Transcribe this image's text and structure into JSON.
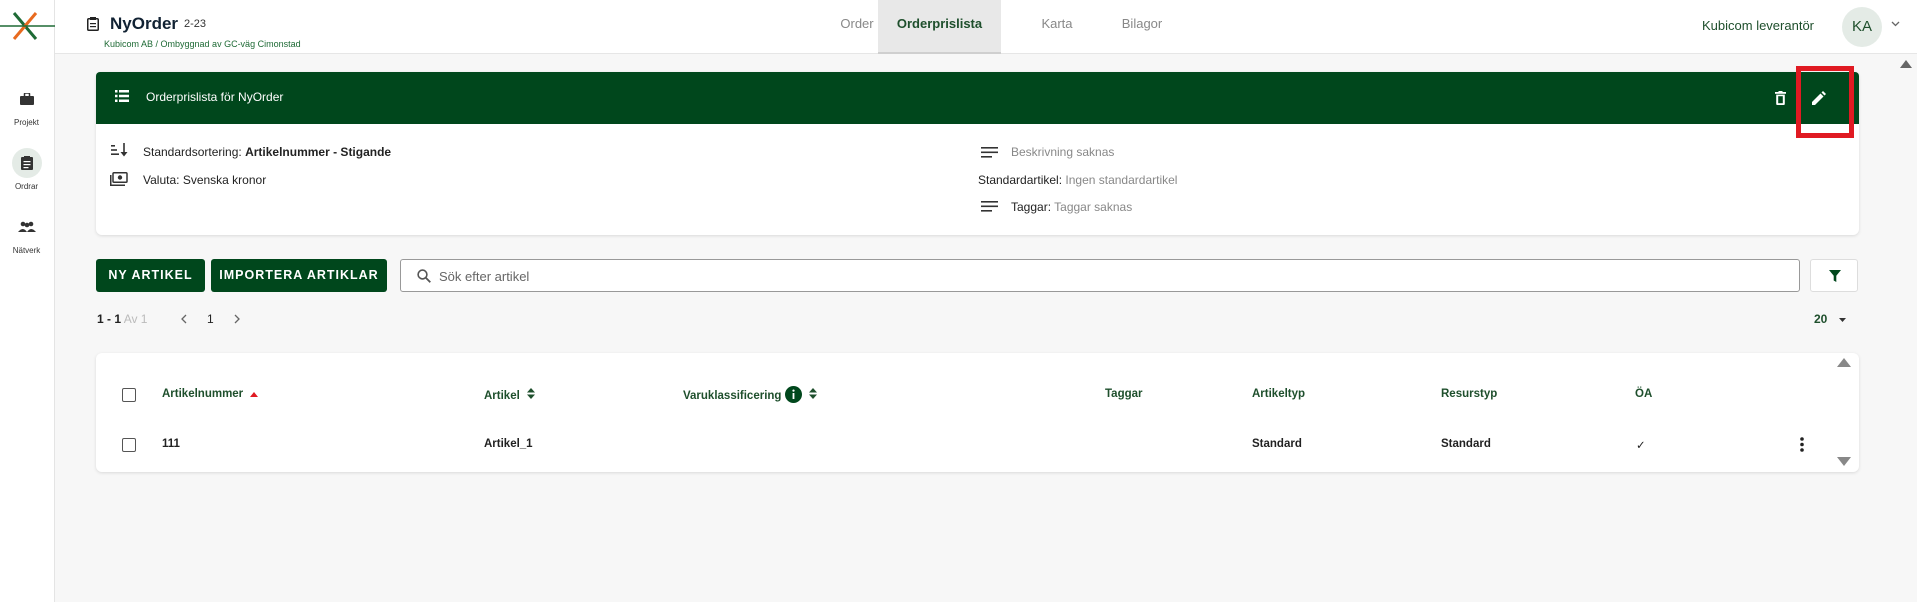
{
  "sidebar": {
    "items": [
      {
        "label": "Projekt",
        "icon": "briefcase-icon"
      },
      {
        "label": "Ordrar",
        "icon": "clipboard-icon"
      },
      {
        "label": "Nätverk",
        "icon": "people-icon"
      }
    ]
  },
  "header": {
    "title": "NyOrder",
    "order_number": "2-23",
    "subtitle": "Kubicom AB / Ombyggnad av GC-väg Cimonstad",
    "tabs": [
      {
        "label": "Order"
      },
      {
        "label": "Orderprislista"
      },
      {
        "label": "Karta"
      },
      {
        "label": "Bilagor"
      }
    ],
    "user_name": "Kubicom leverantör",
    "avatar_initials": "KA"
  },
  "pricelist": {
    "title": "Orderprislista för NyOrder",
    "sort_label": "Standardsortering:",
    "sort_value": "Artikelnummer - Stigande",
    "currency_label": "Valuta:",
    "currency_value": "Svenska kronor",
    "description": "Beskrivning saknas",
    "standard_article_label": "Standardartikel:",
    "standard_article_value": "Ingen standardartikel",
    "tags_label": "Taggar:",
    "tags_value": "Taggar saknas"
  },
  "actions": {
    "new_article": "NY ARTIKEL",
    "import_articles": "IMPORTERA ARTIKLAR",
    "search_placeholder": "Sök efter artikel"
  },
  "pagination": {
    "range": "1 - 1",
    "of_total": "Av 1",
    "page": "1",
    "page_size": "20"
  },
  "table": {
    "columns": [
      "Artikelnummer",
      "Artikel",
      "Varuklassificering",
      "Taggar",
      "Artikeltyp",
      "Resurstyp",
      "ÖA"
    ],
    "rows": [
      {
        "artikelnummer": "111",
        "artikel": "Artikel_1",
        "varuklassificering": "",
        "taggar": "",
        "artikeltyp": "Standard",
        "resurstyp": "Standard",
        "oa": "✓"
      }
    ]
  },
  "colors": {
    "brand_green": "#00471c",
    "highlight_red": "#e01a22",
    "sort_arrow_red": "#e01a22"
  }
}
